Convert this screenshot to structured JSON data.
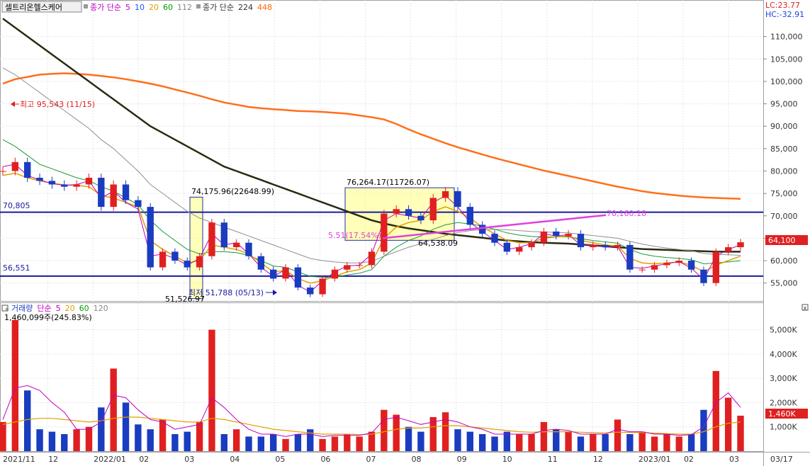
{
  "header": {
    "stock_name": "셀트리온헬스케어",
    "ma_label": "종가 단순",
    "ma_periods": [
      {
        "label": "5",
        "color": "#c000c0"
      },
      {
        "label": "10",
        "color": "#2050ff"
      },
      {
        "label": "20",
        "color": "#e0a000"
      },
      {
        "label": "60",
        "color": "#00a000"
      },
      {
        "label": "112",
        "color": "#888888"
      }
    ],
    "ma2_label": "종가 단순",
    "ma2_periods": [
      {
        "label": "224",
        "color": "#333333"
      },
      {
        "label": "448",
        "color": "#ff6600"
      }
    ],
    "lc": "LC:23.77",
    "hc": "HC:-32.91"
  },
  "volume_header": {
    "label": "거래량",
    "ma_label": "단순",
    "periods": [
      {
        "label": "5",
        "color": "#c000c0"
      },
      {
        "label": "20",
        "color": "#e0a000"
      },
      {
        "label": "60",
        "color": "#00a000"
      },
      {
        "label": "120",
        "color": "#888888"
      }
    ],
    "current": "1,460,099주(245.83%)"
  },
  "annotations": {
    "high": "최고 95,543 (11/15)",
    "low": "최저 51,788 (05/13)",
    "box1_top": "74,175.96(22648.99)",
    "box1_bottom": "51,526.97",
    "box2_top": "76,264.17(11726.07)",
    "box2_bottom": "64,538.09",
    "box2_left": "5.51(17.54%)",
    "trend_end": "70,160.18",
    "hline_upper": "70,805",
    "hline_lower": "56,551",
    "current_price": "64,100",
    "current_volume": "1,460K"
  },
  "chart_data": [
    {
      "type": "candlestick",
      "title": "셀트리온헬스케어",
      "x_ticks": [
        "2021/11",
        "12",
        "2022/01",
        "02",
        "03",
        "04",
        "05",
        "06",
        "07",
        "08",
        "09",
        "10",
        "11",
        "12",
        "2023/01",
        "02",
        "03",
        "03/17"
      ],
      "y_ticks": [
        "110,000",
        "105,000",
        "100,000",
        "95,000",
        "90,000",
        "85,000",
        "80,000",
        "75,000",
        "70,000",
        "65,000",
        "60,000",
        "55,000"
      ],
      "ylim": [
        51000,
        115000
      ],
      "close": [
        80000,
        82000,
        78500,
        77800,
        77000,
        76500,
        77000,
        78500,
        72000,
        77000,
        73500,
        72000,
        58500,
        62000,
        60000,
        58500,
        61000,
        68500,
        63000,
        64000,
        61000,
        58000,
        56000,
        58500,
        54000,
        52500,
        56000,
        58000,
        59000,
        59000,
        62000,
        70500,
        71500,
        70000,
        69000,
        74000,
        75500,
        72000,
        68000,
        66000,
        64000,
        62000,
        63000,
        64000,
        66500,
        65500,
        66000,
        63000,
        63500,
        63000,
        63500,
        58000,
        58000,
        59000,
        59500,
        60000,
        58000,
        55000,
        62000,
        63000,
        64100
      ],
      "ma5": [
        81000,
        81500,
        79000,
        78000,
        77200,
        76800,
        77000,
        77800,
        74000,
        75500,
        73000,
        71500,
        61000,
        61500,
        60500,
        59000,
        60500,
        66000,
        63500,
        64000,
        61500,
        58500,
        56500,
        58000,
        54500,
        53000,
        55500,
        57500,
        58800,
        59000,
        61500,
        69000,
        70500,
        70000,
        69500,
        73000,
        74500,
        72000,
        68500,
        66500,
        64500,
        62500,
        63000,
        63800,
        66000,
        65500,
        65800,
        63500,
        63500,
        63000,
        63200,
        58500,
        58300,
        58800,
        59300,
        59800,
        58300,
        55800,
        61000,
        62500,
        63500
      ],
      "ma20": [
        79000,
        79500,
        78500,
        77800,
        77300,
        76900,
        76800,
        76500,
        74500,
        74000,
        73000,
        72000,
        64500,
        62500,
        61000,
        59500,
        60000,
        63500,
        63000,
        62500,
        61500,
        59500,
        57500,
        57800,
        56000,
        55000,
        55500,
        56500,
        57500,
        58000,
        59500,
        65000,
        67500,
        68500,
        69000,
        71000,
        72000,
        71000,
        69500,
        67500,
        66000,
        64500,
        64000,
        64000,
        65000,
        65300,
        65500,
        64500,
        64000,
        63500,
        63300,
        60500,
        59500,
        59300,
        59500,
        59700,
        59000,
        57500,
        59000,
        60000,
        61000
      ],
      "ma60": [
        87000,
        85500,
        83500,
        81500,
        80500,
        79500,
        78500,
        77800,
        76500,
        75500,
        74000,
        72500,
        69000,
        66500,
        64500,
        62500,
        61500,
        62000,
        62000,
        61800,
        61200,
        60000,
        58800,
        58500,
        57500,
        56500,
        56300,
        56300,
        56800,
        57200,
        58000,
        61000,
        63000,
        64500,
        65500,
        67000,
        68000,
        68500,
        68200,
        67700,
        67000,
        66200,
        65700,
        65400,
        65300,
        65300,
        65300,
        64900,
        64500,
        64200,
        63900,
        62500,
        61500,
        61000,
        60700,
        60500,
        60200,
        59300,
        59500,
        59700,
        60000
      ],
      "ma112": [
        103000,
        101500,
        99500,
        97500,
        95500,
        93500,
        91500,
        89500,
        87000,
        85000,
        82500,
        80000,
        77000,
        75000,
        73000,
        71000,
        69500,
        68500,
        67500,
        66500,
        65500,
        64500,
        63500,
        62500,
        61500,
        60500,
        60000,
        59700,
        59500,
        59500,
        59800,
        61000,
        62000,
        63000,
        63800,
        64800,
        65600,
        66300,
        66700,
        66900,
        67000,
        66900,
        66700,
        66500,
        66400,
        66300,
        66200,
        65900,
        65600,
        65300,
        65000,
        64300,
        63700,
        63200,
        62800,
        62500,
        62200,
        61600,
        61400,
        61300,
        61200
      ],
      "ma224": [
        114000,
        112000,
        110000,
        108000,
        106000,
        104000,
        102000,
        100000,
        98000,
        96000,
        94000,
        92000,
        90000,
        88500,
        87000,
        85500,
        84000,
        82500,
        81000,
        80000,
        79000,
        78000,
        77000,
        76000,
        75000,
        74000,
        73000,
        72000,
        71000,
        70000,
        69000,
        68300,
        67700,
        67200,
        66800,
        66400,
        66000,
        65700,
        65400,
        65100,
        64800,
        64500,
        64300,
        64100,
        64000,
        63900,
        63800,
        63600,
        63400,
        63200,
        63000,
        62800,
        62600,
        62500,
        62400,
        62300,
        62200,
        62100,
        62000,
        62000,
        62000
      ],
      "ma448": [
        99500,
        100500,
        101000,
        101500,
        101700,
        101800,
        101700,
        101500,
        101200,
        100900,
        100500,
        100000,
        99500,
        98900,
        98200,
        97500,
        96800,
        96000,
        95300,
        94800,
        94300,
        94000,
        93800,
        93600,
        93400,
        93300,
        93200,
        93000,
        92800,
        92400,
        92000,
        91500,
        90500,
        89300,
        88200,
        87200,
        86200,
        85300,
        84500,
        83700,
        82900,
        82200,
        81500,
        80800,
        80100,
        79500,
        78900,
        78300,
        77700,
        77100,
        76500,
        76000,
        75500,
        75100,
        74800,
        74500,
        74300,
        74100,
        74000,
        73900,
        73800
      ]
    },
    {
      "type": "bar",
      "title": "거래량",
      "y_ticks": [
        "5,000K",
        "4,000K",
        "3,000K",
        "2,000K",
        "1,000K"
      ],
      "ylim": [
        0,
        5600
      ],
      "values": [
        1200,
        5400,
        2500,
        900,
        800,
        700,
        900,
        1000,
        1800,
        3400,
        2000,
        1100,
        900,
        1300,
        700,
        800,
        1200,
        5000,
        700,
        900,
        600,
        600,
        700,
        500,
        700,
        900,
        500,
        600,
        700,
        600,
        800,
        1700,
        1500,
        1000,
        800,
        1400,
        1600,
        900,
        800,
        700,
        600,
        800,
        700,
        700,
        1200,
        900,
        800,
        600,
        700,
        700,
        1300,
        700,
        800,
        600,
        700,
        600,
        700,
        1700,
        3300,
        2200,
        1460
      ],
      "ma5": [
        1300,
        2600,
        2700,
        2500,
        2000,
        1600,
        900,
        900,
        1200,
        2300,
        2200,
        1700,
        1300,
        1200,
        900,
        1000,
        1100,
        2200,
        1800,
        1300,
        900,
        700,
        700,
        600,
        700,
        700,
        600,
        650,
        650,
        650,
        750,
        1300,
        1400,
        1250,
        1100,
        1200,
        1300,
        1200,
        1000,
        900,
        700,
        700,
        700,
        700,
        850,
        900,
        850,
        700,
        700,
        700,
        900,
        800,
        800,
        700,
        700,
        650,
        680,
        1000,
        2000,
        2400,
        1800
      ],
      "ma20": [
        1100,
        1200,
        1300,
        1350,
        1350,
        1300,
        1250,
        1200,
        1250,
        1350,
        1400,
        1400,
        1350,
        1300,
        1250,
        1200,
        1200,
        1350,
        1300,
        1200,
        1100,
        1000,
        900,
        850,
        800,
        750,
        700,
        700,
        700,
        680,
        700,
        800,
        900,
        950,
        950,
        1000,
        1050,
        1050,
        1000,
        950,
        900,
        850,
        800,
        780,
        800,
        800,
        800,
        780,
        760,
        750,
        780,
        770,
        760,
        740,
        720,
        700,
        700,
        800,
        1000,
        1150,
        1200
      ]
    }
  ]
}
